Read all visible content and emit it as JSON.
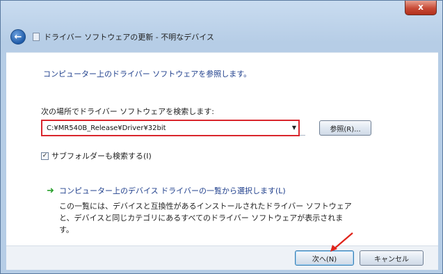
{
  "window": {
    "close_label": "x",
    "title": "ドライバー ソフトウェアの更新 - 不明なデバイス"
  },
  "main": {
    "heading": "コンピューター上のドライバー ソフトウェアを参照します。",
    "search_label": "次の場所でドライバー ソフトウェアを検索します:",
    "path_value": "C:¥MR540B_Release¥Driver¥32bit",
    "browse_label": "参照(R)...",
    "include_subfolders_label": "サブフォルダーも検索する(I)",
    "include_subfolders_checked": true,
    "option_title": "コンピューター上のデバイス ドライバーの一覧から選択します(L)",
    "option_desc_lines": [
      "この一覧には、デバイスと互換性があるインストールされたドライバー ソフトウェア",
      "と、デバイスと同じカテゴリにあるすべてのドライバー ソフトウェアが表示されま",
      "す。"
    ]
  },
  "footer": {
    "next_label": "次へ(N)",
    "cancel_label": "キャンセル"
  },
  "colors": {
    "highlight_box": "#d9262d",
    "link_blue": "#1f3f8c",
    "annotation_arrow": "#e0241b"
  },
  "icons": {
    "back": "back-arrow-icon",
    "device": "device-icon",
    "option": "green-arrow-icon",
    "dropdown": "chevron-down-icon"
  }
}
